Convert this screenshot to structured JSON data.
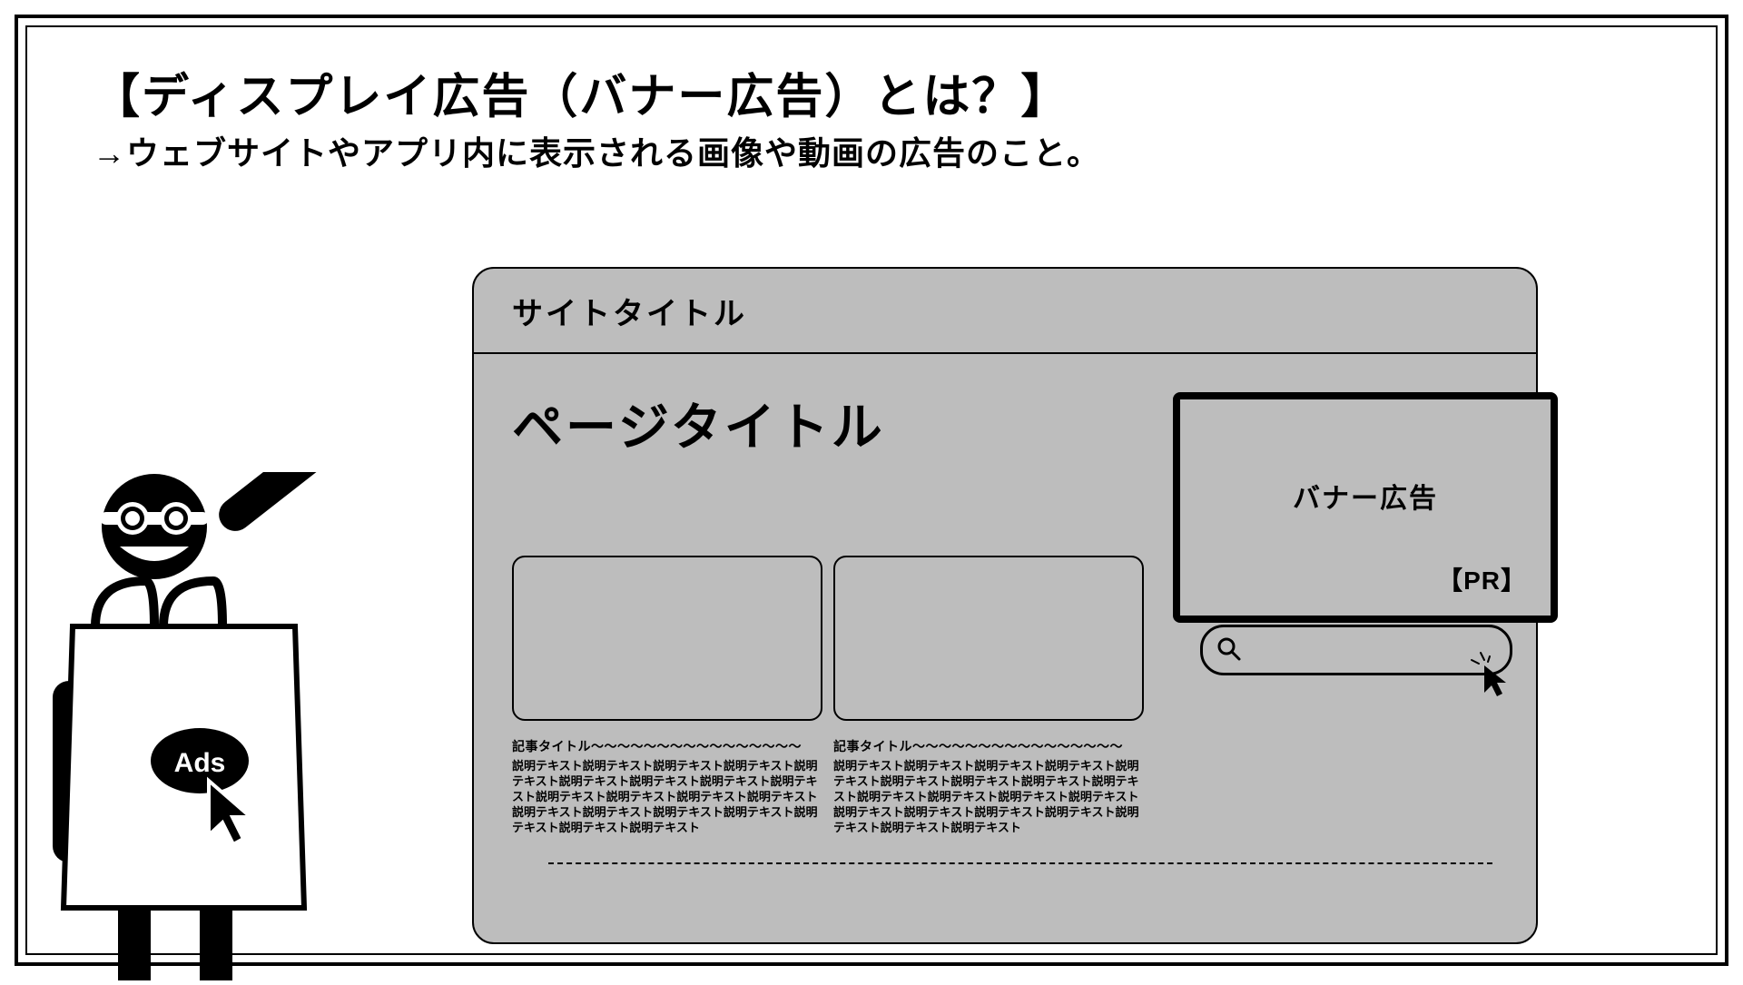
{
  "header": {
    "title": "【ディスプレイ広告（バナー広告）とは？】",
    "subtitle": "→ウェブサイトやアプリ内に表示される画像や動画の広告のこと。"
  },
  "mockup": {
    "site_title": "サイトタイトル",
    "page_title": "ページタイトル",
    "article1": {
      "title": "記事タイトル〜〜〜〜〜〜〜〜〜〜〜〜〜〜〜〜",
      "body": "説明テキスト説明テキスト説明テキスト説明テキスト説明テキスト説明テキスト説明テキスト説明テキスト説明テキスト説明テキスト説明テキスト説明テキスト説明テキスト説明テキスト説明テキスト説明テキスト説明テキスト説明テキスト説明テキスト説明テキスト"
    },
    "article2": {
      "title": "記事タイトル〜〜〜〜〜〜〜〜〜〜〜〜〜〜〜〜",
      "body": "説明テキスト説明テキスト説明テキスト説明テキスト説明テキスト説明テキスト説明テキスト説明テキスト説明テキスト説明テキスト説明テキスト説明テキスト説明テキスト説明テキスト説明テキスト説明テキスト説明テキスト説明テキスト説明テキスト説明テキスト"
    },
    "banner": {
      "label": "バナー広告",
      "pr": "【PR】"
    }
  },
  "mascot": {
    "badge": "Ads"
  }
}
